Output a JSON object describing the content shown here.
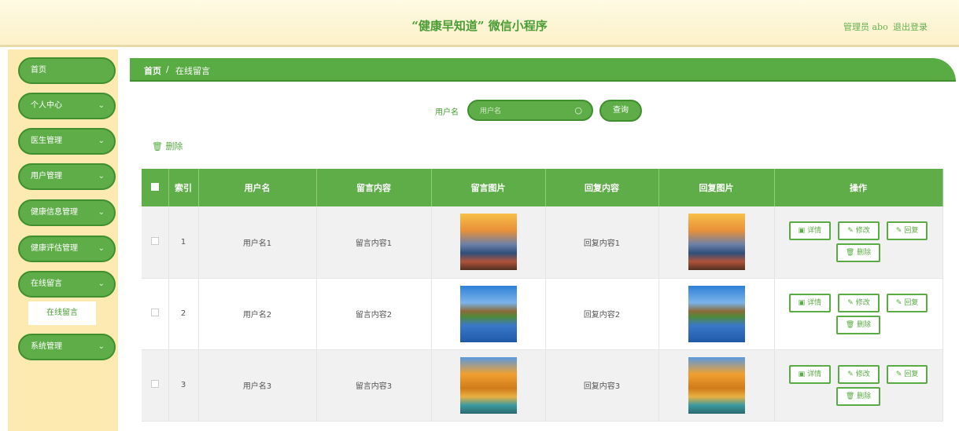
{
  "header": {
    "title": "“健康早知道” 微信小程序",
    "admin": "管理员 abo",
    "logout": "退出登录"
  },
  "sidebar": {
    "items": [
      {
        "label": "首页",
        "chev": ""
      },
      {
        "label": "个人中心",
        "chev": "⌄"
      },
      {
        "label": "医生管理",
        "chev": "⌄"
      },
      {
        "label": "用户管理",
        "chev": "⌄"
      },
      {
        "label": "健康信息管理",
        "chev": "⌄"
      },
      {
        "label": "健康评估管理",
        "chev": "⌄"
      },
      {
        "label": "在线留言",
        "chev": "⌄"
      },
      {
        "label": "系统管理",
        "chev": "⌄"
      }
    ],
    "submenu": "在线留言"
  },
  "breadcrumb": {
    "home": "首页",
    "sep": "/",
    "current": "在线留言"
  },
  "search": {
    "label": "用户名",
    "placeholder": "用户名",
    "button": "查询"
  },
  "toolbar": {
    "delete": "删除"
  },
  "table": {
    "headers": [
      "索引",
      "用户名",
      "留言内容",
      "留言图片",
      "回复内容",
      "回复图片",
      "操作"
    ],
    "rows": [
      {
        "index": "1",
        "user": "用户名1",
        "content": "留言内容1",
        "reply": "回复内容1",
        "image": "sunset-image"
      },
      {
        "index": "2",
        "user": "用户名2",
        "content": "留言内容2",
        "reply": "回复内容2",
        "image": "lake-image"
      },
      {
        "index": "3",
        "user": "用户名3",
        "content": "留言内容3",
        "reply": "回复内容3",
        "image": "autumn-image"
      }
    ],
    "actions": {
      "detail": "详情",
      "edit": "修改",
      "reply": "回复",
      "delete": "删除"
    }
  },
  "colors": {
    "primary": "#5fad48",
    "sidebar_bg": "#fdeab0",
    "header_bg": "#fbf0c8"
  }
}
